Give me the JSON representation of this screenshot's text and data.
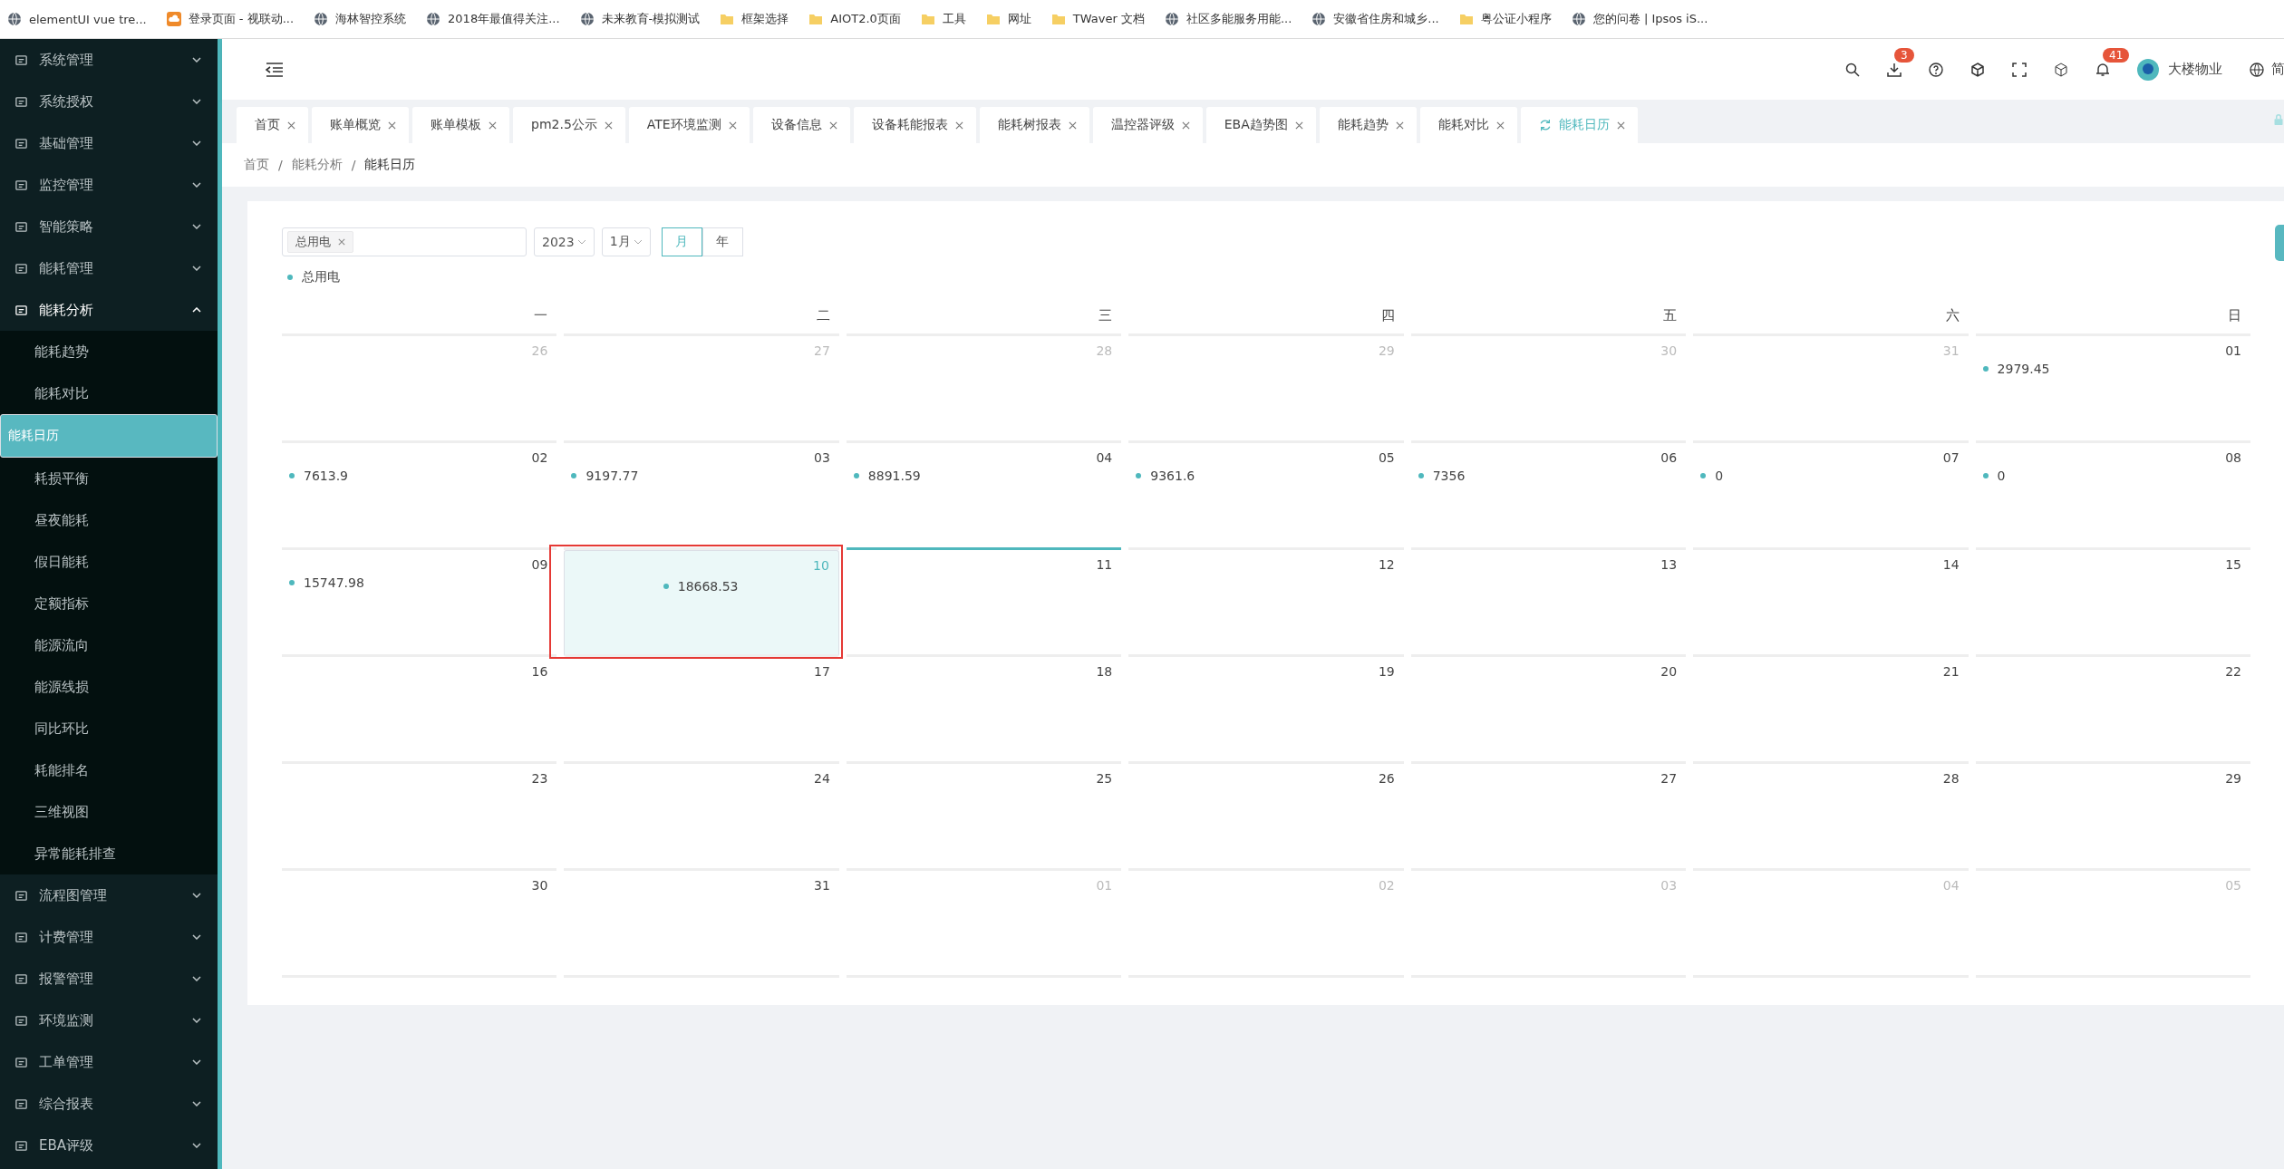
{
  "bookmarks": [
    {
      "label": "elementUI vue tre...",
      "kind": "site"
    },
    {
      "label": "登录页面 - 视联动...",
      "kind": "app"
    },
    {
      "label": "海林智控系统",
      "kind": "site"
    },
    {
      "label": "2018年最值得关注...",
      "kind": "site"
    },
    {
      "label": "未来教育-模拟测试",
      "kind": "site"
    },
    {
      "label": "框架选择",
      "kind": "folder"
    },
    {
      "label": "AIOT2.0页面",
      "kind": "folder"
    },
    {
      "label": "工具",
      "kind": "folder"
    },
    {
      "label": "网址",
      "kind": "folder"
    },
    {
      "label": "TWaver 文档",
      "kind": "folder"
    },
    {
      "label": "社区多能服务用能...",
      "kind": "site"
    },
    {
      "label": "安徽省住房和城乡...",
      "kind": "site"
    },
    {
      "label": "粤公证小程序",
      "kind": "folder"
    },
    {
      "label": "您的问卷 | Ipsos iS...",
      "kind": "site"
    }
  ],
  "sidebar": {
    "items": [
      {
        "label": "系统管理",
        "expanded": false
      },
      {
        "label": "系统授权",
        "expanded": false
      },
      {
        "label": "基础管理",
        "expanded": false
      },
      {
        "label": "监控管理",
        "expanded": false
      },
      {
        "label": "智能策略",
        "expanded": false
      },
      {
        "label": "能耗管理",
        "expanded": false
      },
      {
        "label": "能耗分析",
        "expanded": true,
        "children": [
          {
            "label": "能耗趋势",
            "selected": false
          },
          {
            "label": "能耗对比",
            "selected": false
          },
          {
            "label": "能耗日历",
            "selected": true
          },
          {
            "label": "耗损平衡",
            "selected": false
          },
          {
            "label": "昼夜能耗",
            "selected": false
          },
          {
            "label": "假日能耗",
            "selected": false
          },
          {
            "label": "定额指标",
            "selected": false
          },
          {
            "label": "能源流向",
            "selected": false
          },
          {
            "label": "能源线损",
            "selected": false
          },
          {
            "label": "同比环比",
            "selected": false
          },
          {
            "label": "耗能排名",
            "selected": false
          },
          {
            "label": "三维视图",
            "selected": false
          },
          {
            "label": "异常能耗排查",
            "selected": false
          }
        ]
      },
      {
        "label": "流程图管理",
        "expanded": false
      },
      {
        "label": "计费管理",
        "expanded": false
      },
      {
        "label": "报警管理",
        "expanded": false
      },
      {
        "label": "环境监测",
        "expanded": false
      },
      {
        "label": "工单管理",
        "expanded": false
      },
      {
        "label": "综合报表",
        "expanded": false
      },
      {
        "label": "EBA评级",
        "expanded": false
      }
    ]
  },
  "header": {
    "download_badge": "3",
    "notification_badge": "41",
    "user": "大楼物业",
    "language": "简"
  },
  "tabs": [
    {
      "label": "首页",
      "selected": false
    },
    {
      "label": "账单概览",
      "selected": false
    },
    {
      "label": "账单模板",
      "selected": false
    },
    {
      "label": "pm2.5公示",
      "selected": false
    },
    {
      "label": "ATE环境监测",
      "selected": false
    },
    {
      "label": "设备信息",
      "selected": false
    },
    {
      "label": "设备耗能报表",
      "selected": false
    },
    {
      "label": "能耗树报表",
      "selected": false
    },
    {
      "label": "温控器评级",
      "selected": false
    },
    {
      "label": "EBA趋势图",
      "selected": false
    },
    {
      "label": "能耗趋势",
      "selected": false
    },
    {
      "label": "能耗对比",
      "selected": false
    },
    {
      "label": "能耗日历",
      "selected": true
    }
  ],
  "breadcrumb": {
    "separator": "/",
    "items": [
      "首页",
      "能耗分析",
      "能耗日历"
    ]
  },
  "filters": {
    "tag": "总用电",
    "year": "2023",
    "month": "1月",
    "modes": [
      {
        "label": "月",
        "selected": true
      },
      {
        "label": "年",
        "selected": false
      }
    ]
  },
  "legend": {
    "label": "总用电",
    "color": "#4fb8bd"
  },
  "calendar": {
    "weekdays": [
      "一",
      "二",
      "三",
      "四",
      "五",
      "六",
      "日"
    ],
    "days": [
      {
        "date": "26",
        "other_month": true,
        "selected": false,
        "today": false
      },
      {
        "date": "27",
        "other_month": true,
        "selected": false,
        "today": false
      },
      {
        "date": "28",
        "other_month": true,
        "selected": false,
        "today": false
      },
      {
        "date": "29",
        "other_month": true,
        "selected": false,
        "today": false
      },
      {
        "date": "30",
        "other_month": true,
        "selected": false,
        "today": false
      },
      {
        "date": "31",
        "other_month": true,
        "selected": false,
        "today": false
      },
      {
        "date": "01",
        "value": "2979.45",
        "other_month": false,
        "selected": false,
        "today": false
      },
      {
        "date": "02",
        "value": "7613.9",
        "other_month": false,
        "selected": false,
        "today": false
      },
      {
        "date": "03",
        "value": "9197.77",
        "other_month": false,
        "selected": false,
        "today": false
      },
      {
        "date": "04",
        "value": "8891.59",
        "other_month": false,
        "selected": false,
        "today": false
      },
      {
        "date": "05",
        "value": "9361.6",
        "other_month": false,
        "selected": false,
        "today": false
      },
      {
        "date": "06",
        "value": "7356",
        "other_month": false,
        "selected": false,
        "today": false
      },
      {
        "date": "07",
        "value": "0",
        "other_month": false,
        "selected": false,
        "today": false
      },
      {
        "date": "08",
        "value": "0",
        "other_month": false,
        "selected": false,
        "today": false
      },
      {
        "date": "09",
        "value": "15747.98",
        "other_month": false,
        "selected": false,
        "today": false
      },
      {
        "date": "10",
        "value": "18668.53",
        "other_month": false,
        "selected": true,
        "today": false,
        "annotated": true
      },
      {
        "date": "11",
        "other_month": false,
        "selected": false,
        "today": true
      },
      {
        "date": "12",
        "other_month": false,
        "selected": false,
        "today": false
      },
      {
        "date": "13",
        "other_month": false,
        "selected": false,
        "today": false
      },
      {
        "date": "14",
        "other_month": false,
        "selected": false,
        "today": false
      },
      {
        "date": "15",
        "other_month": false,
        "selected": false,
        "today": false
      },
      {
        "date": "16",
        "other_month": false,
        "selected": false,
        "today": false
      },
      {
        "date": "17",
        "other_month": false,
        "selected": false,
        "today": false
      },
      {
        "date": "18",
        "other_month": false,
        "selected": false,
        "today": false
      },
      {
        "date": "19",
        "other_month": false,
        "selected": false,
        "today": false
      },
      {
        "date": "20",
        "other_month": false,
        "selected": false,
        "today": false
      },
      {
        "date": "21",
        "other_month": false,
        "selected": false,
        "today": false
      },
      {
        "date": "22",
        "other_month": false,
        "selected": false,
        "today": false
      },
      {
        "date": "23",
        "other_month": false,
        "selected": false,
        "today": false
      },
      {
        "date": "24",
        "other_month": false,
        "selected": false,
        "today": false
      },
      {
        "date": "25",
        "other_month": false,
        "selected": false,
        "today": false
      },
      {
        "date": "26",
        "other_month": false,
        "selected": false,
        "today": false
      },
      {
        "date": "27",
        "other_month": false,
        "selected": false,
        "today": false
      },
      {
        "date": "28",
        "other_month": false,
        "selected": false,
        "today": false
      },
      {
        "date": "29",
        "other_month": false,
        "selected": false,
        "today": false
      },
      {
        "date": "30",
        "other_month": false,
        "selected": false,
        "today": false
      },
      {
        "date": "31",
        "other_month": false,
        "selected": false,
        "today": false
      },
      {
        "date": "01",
        "other_month": true,
        "selected": false,
        "today": false
      },
      {
        "date": "02",
        "other_month": true,
        "selected": false,
        "today": false
      },
      {
        "date": "03",
        "other_month": true,
        "selected": false,
        "today": false
      },
      {
        "date": "04",
        "other_month": true,
        "selected": false,
        "today": false
      },
      {
        "date": "05",
        "other_month": true,
        "selected": false,
        "today": false
      }
    ]
  }
}
